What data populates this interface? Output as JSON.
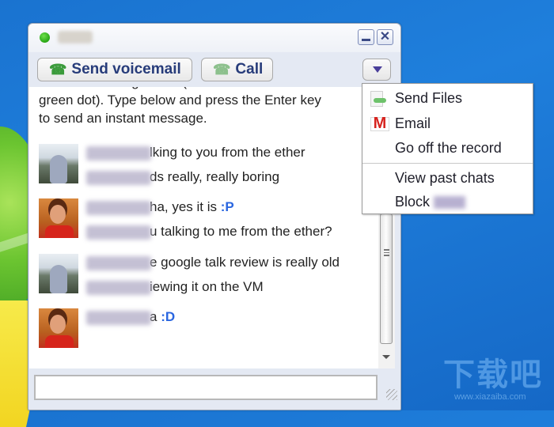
{
  "window": {
    "contact_name": "Mike",
    "status": "online",
    "status_color": "#2fb31a",
    "minimize_label": "_",
    "close_label": "✕"
  },
  "toolbar": {
    "voicemail_label": "Send voicemail",
    "call_label": "Call",
    "phone_icon": "☎",
    "more_icon": "triangle-down"
  },
  "chat": {
    "intro_partial": "Mike is online right now (online friends have a",
    "intro_line2": "green dot). Type below and press the Enter key",
    "intro_line3": "to send an instant message.",
    "groups": [
      {
        "avatar": "hooded-person",
        "lines": [
          {
            "visible_text": "lking to you from the ether",
            "emoticon": ""
          },
          {
            "visible_text": "ds really, really boring",
            "emoticon": ""
          }
        ]
      },
      {
        "avatar": "red-shirt-person",
        "lines": [
          {
            "visible_text": "ha, yes it is ",
            "emoticon": ":P"
          },
          {
            "visible_text": "u talking to me from the ether?",
            "emoticon": ""
          }
        ]
      },
      {
        "avatar": "hooded-person",
        "lines": [
          {
            "visible_text": "e google talk review is really old",
            "emoticon": ""
          },
          {
            "visible_text": "iewing it on the VM",
            "emoticon": ""
          }
        ]
      },
      {
        "avatar": "red-shirt-person",
        "lines": [
          {
            "visible_text": "a ",
            "emoticon": ":D"
          }
        ]
      }
    ]
  },
  "input": {
    "value": "",
    "placeholder": ""
  },
  "menu": {
    "items": [
      {
        "label": "Send Files",
        "icon": "send-files"
      },
      {
        "label": "Email",
        "icon": "gmail"
      },
      {
        "label": "Go off the record",
        "icon": ""
      },
      {
        "label": "View past chats",
        "icon": ""
      },
      {
        "label": "Block",
        "icon": "",
        "suffix_blurred": "Mike"
      }
    ]
  },
  "watermark": {
    "big": "下载吧",
    "small": "www.xiazaiba.com"
  }
}
